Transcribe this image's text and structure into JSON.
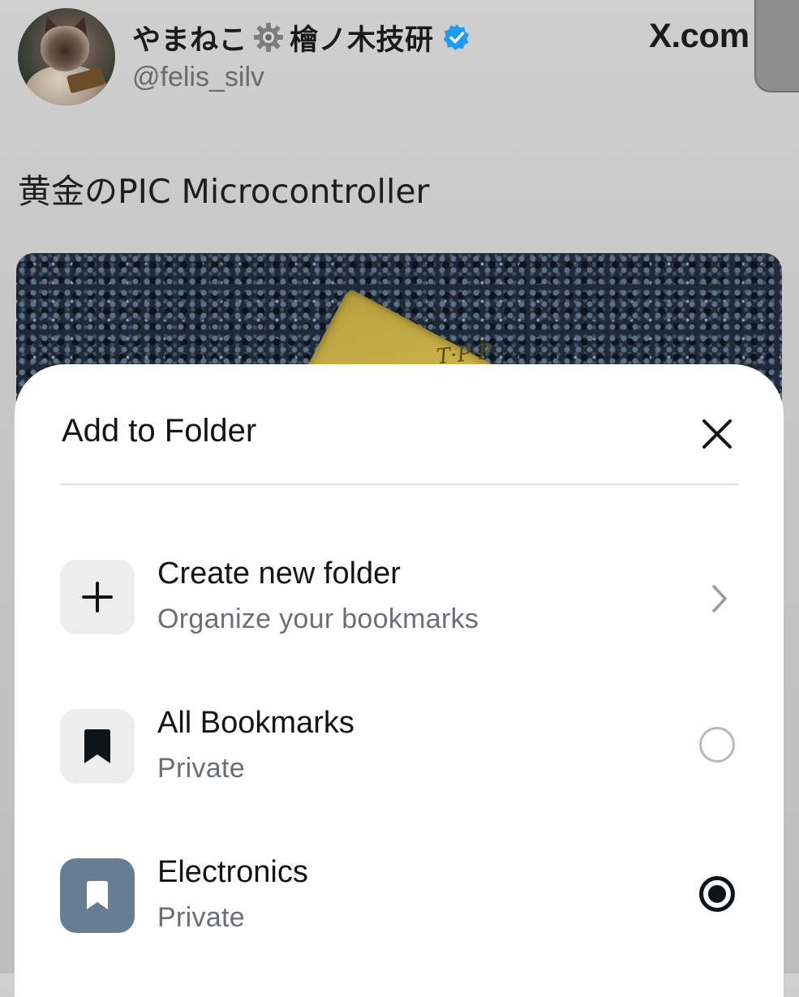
{
  "post": {
    "author_name_part1": "やまねこ",
    "author_name_part2": "檜ノ木技研",
    "handle": "@felis_silv",
    "site": "X.com",
    "text": "黄金のPIC Microcontroller"
  },
  "sheet": {
    "title": "Add to Folder",
    "options": [
      {
        "title": "Create new folder",
        "subtitle": "Organize your bookmarks",
        "icon": "plus-icon",
        "control": "chevron"
      },
      {
        "title": "All Bookmarks",
        "subtitle": "Private",
        "icon": "bookmark-icon",
        "selected": false
      },
      {
        "title": "Electronics",
        "subtitle": "Private",
        "icon": "bookmark-icon",
        "selected": true
      }
    ]
  },
  "colors": {
    "accent_verified": "#1d9bf0",
    "folder_icon_bg": "#667d92",
    "text_primary": "#141414",
    "text_secondary": "#6b6f73"
  },
  "icons": [
    "gear-icon",
    "verified-badge-icon",
    "x-logo",
    "close-icon",
    "plus-icon",
    "chevron-right-icon",
    "bookmark-icon"
  ]
}
